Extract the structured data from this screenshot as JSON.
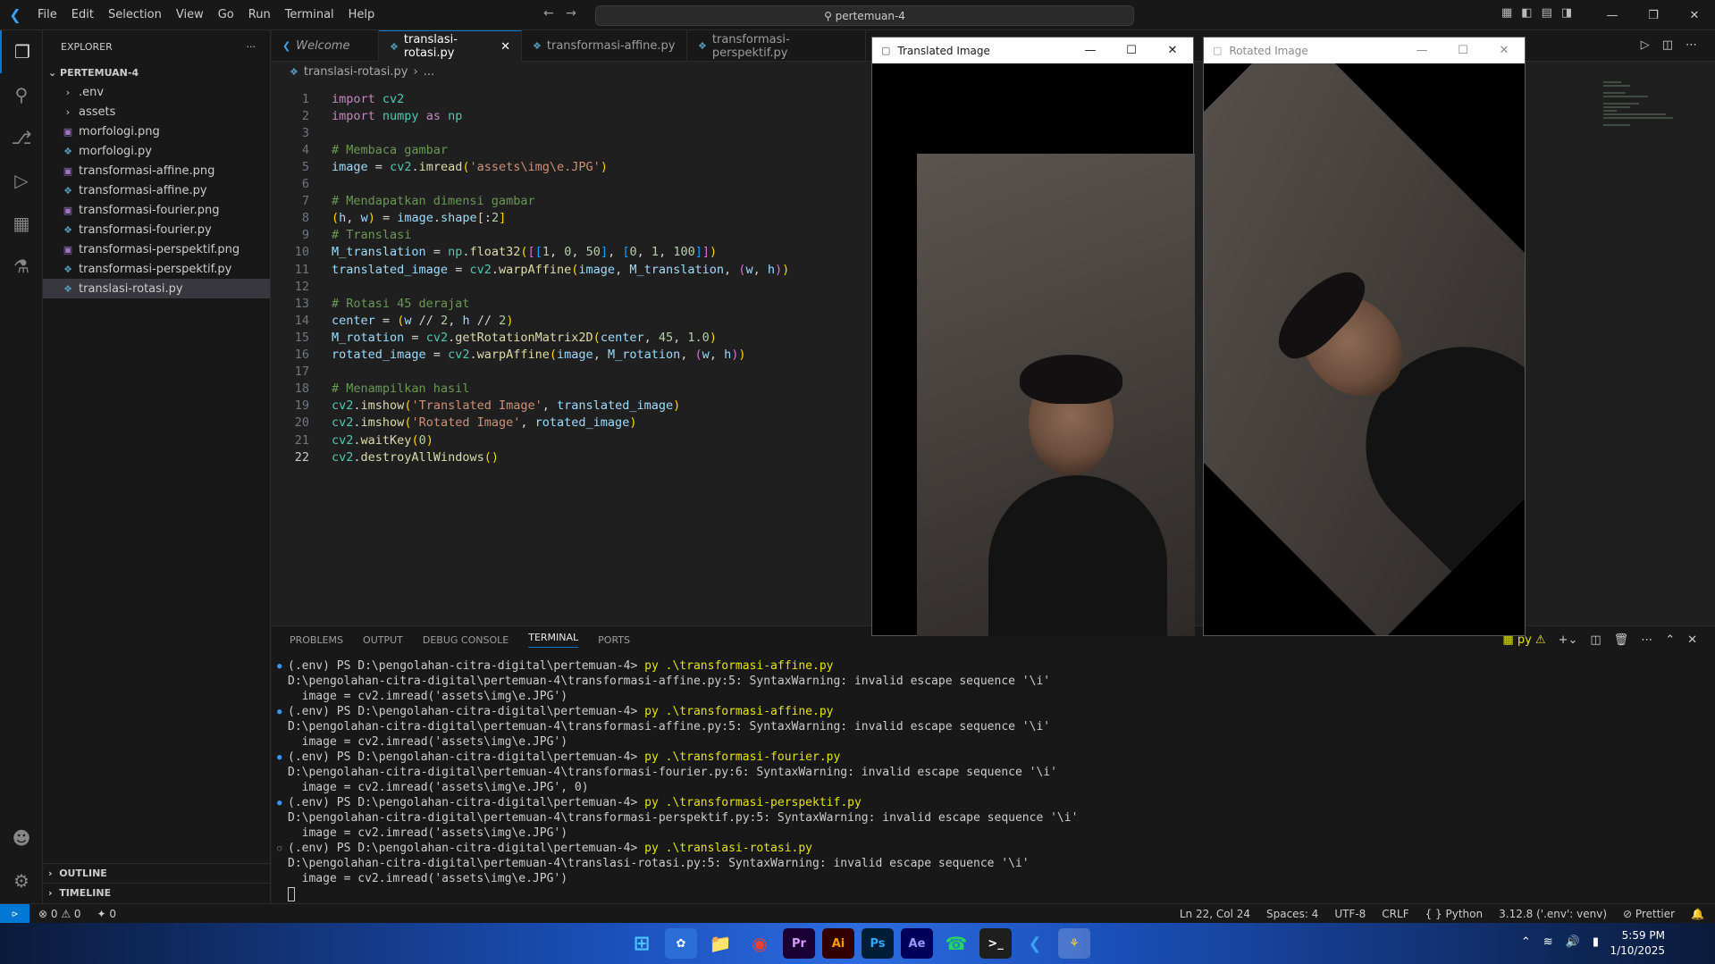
{
  "titlebar": {
    "menu": [
      "File",
      "Edit",
      "Selection",
      "View",
      "Go",
      "Run",
      "Terminal",
      "Help"
    ],
    "search": "pertemuan-4"
  },
  "sidebar": {
    "header": "EXPLORER",
    "more": "···",
    "folder": "PERTEMUAN-4",
    "items": [
      {
        "label": ".env",
        "type": "folder"
      },
      {
        "label": "assets",
        "type": "folder"
      },
      {
        "label": "morfologi.png",
        "type": "png"
      },
      {
        "label": "morfologi.py",
        "type": "py"
      },
      {
        "label": "transformasi-affine.png",
        "type": "png"
      },
      {
        "label": "transformasi-affine.py",
        "type": "py"
      },
      {
        "label": "transformasi-fourier.png",
        "type": "png"
      },
      {
        "label": "transformasi-fourier.py",
        "type": "py"
      },
      {
        "label": "transformasi-perspektif.png",
        "type": "png"
      },
      {
        "label": "transformasi-perspektif.py",
        "type": "py"
      },
      {
        "label": "translasi-rotasi.py",
        "type": "py"
      }
    ],
    "outline": "OUTLINE",
    "timeline": "TIMELINE"
  },
  "tabs": [
    {
      "label": "Welcome"
    },
    {
      "label": "translasi-rotasi.py"
    },
    {
      "label": "transformasi-affine.py"
    },
    {
      "label": "transformasi-perspektif.py"
    }
  ],
  "breadcrumb": {
    "file": "translasi-rotasi.py",
    "rest": "..."
  },
  "editor": {
    "lines": [
      "import cv2",
      "import numpy as np",
      "",
      "# Membaca gambar",
      "image = cv2.imread('assets\\img\\e.JPG')",
      "",
      "# Mendapatkan dimensi gambar",
      "(h, w) = image.shape[:2]",
      "# Translasi",
      "M_translation = np.float32([[1, 0, 50], [0, 1, 100]])",
      "translated_image = cv2.warpAffine(image, M_translation, (w, h))",
      "",
      "# Rotasi 45 derajat",
      "center = (w // 2, h // 2)",
      "M_rotation = cv2.getRotationMatrix2D(center, 45, 1.0)",
      "rotated_image = cv2.warpAffine(image, M_rotation, (w, h))",
      "",
      "# Menampilkan hasil",
      "cv2.imshow('Translated Image', translated_image)",
      "cv2.imshow('Rotated Image', rotated_image)",
      "cv2.waitKey(0)",
      "cv2.destroyAllWindows()"
    ],
    "line_numbers": [
      "1",
      "2",
      "3",
      "4",
      "5",
      "6",
      "7",
      "8",
      "9",
      "10",
      "11",
      "12",
      "13",
      "14",
      "15",
      "16",
      "17",
      "18",
      "19",
      "20",
      "21",
      "22"
    ]
  },
  "panel": {
    "tabs": [
      "PROBLEMS",
      "OUTPUT",
      "DEBUG CONSOLE",
      "TERMINAL",
      "PORTS"
    ],
    "active_tab": "TERMINAL",
    "terminal": [
      {
        "prompt": "(.env) PS D:\\pengolahan-citra-digital\\pertemuan-4> ",
        "cmd": "py .\\transformasi-affine.py",
        "done": true
      },
      {
        "text": "D:\\pengolahan-citra-digital\\pertemuan-4\\transformasi-affine.py:5: SyntaxWarning: invalid escape sequence '\\i'"
      },
      {
        "text": "  image = cv2.imread('assets\\img\\e.JPG')"
      },
      {
        "prompt": "(.env) PS D:\\pengolahan-citra-digital\\pertemuan-4> ",
        "cmd": "py .\\transformasi-affine.py",
        "done": true
      },
      {
        "text": "D:\\pengolahan-citra-digital\\pertemuan-4\\transformasi-affine.py:5: SyntaxWarning: invalid escape sequence '\\i'"
      },
      {
        "text": "  image = cv2.imread('assets\\img\\e.JPG')"
      },
      {
        "prompt": "(.env) PS D:\\pengolahan-citra-digital\\pertemuan-4> ",
        "cmd": "py .\\transformasi-fourier.py",
        "done": true
      },
      {
        "text": "D:\\pengolahan-citra-digital\\pertemuan-4\\transformasi-fourier.py:6: SyntaxWarning: invalid escape sequence '\\i'"
      },
      {
        "text": "  image = cv2.imread('assets\\img\\e.JPG', 0)"
      },
      {
        "prompt": "(.env) PS D:\\pengolahan-citra-digital\\pertemuan-4> ",
        "cmd": "py .\\transformasi-perspektif.py",
        "done": true
      },
      {
        "text": "D:\\pengolahan-citra-digital\\pertemuan-4\\transformasi-perspektif.py:5: SyntaxWarning: invalid escape sequence '\\i'"
      },
      {
        "text": "  image = cv2.imread('assets\\img\\e.JPG')"
      },
      {
        "prompt": "(.env) PS D:\\pengolahan-citra-digital\\pertemuan-4> ",
        "cmd": "py .\\translasi-rotasi.py",
        "done": false
      },
      {
        "text": "D:\\pengolahan-citra-digital\\pertemuan-4\\translasi-rotasi.py:5: SyntaxWarning: invalid escape sequence '\\i'"
      },
      {
        "text": "  image = cv2.imread('assets\\img\\e.JPG')"
      }
    ],
    "shell_label": "py"
  },
  "windows": {
    "translated_title": "Translated Image",
    "rotated_title": "Rotated Image"
  },
  "statusbar": {
    "errors": "0",
    "warnings": "0",
    "ports": "0",
    "position": "Ln 22, Col 24",
    "spaces": "Spaces: 4",
    "encoding": "UTF-8",
    "eol": "CRLF",
    "language": "Python",
    "interpreter": "3.12.8 ('.env': venv)",
    "prettier": "Prettier"
  },
  "taskbar": {
    "apps": [
      "Pr",
      "Ai",
      "Ps",
      "Ae"
    ],
    "time": "5:59 PM",
    "date": "1/10/2025"
  },
  "colors": {
    "accent": "#0078d4",
    "keyword": "#c586c0",
    "string": "#ce9178",
    "comment": "#6a9955"
  }
}
